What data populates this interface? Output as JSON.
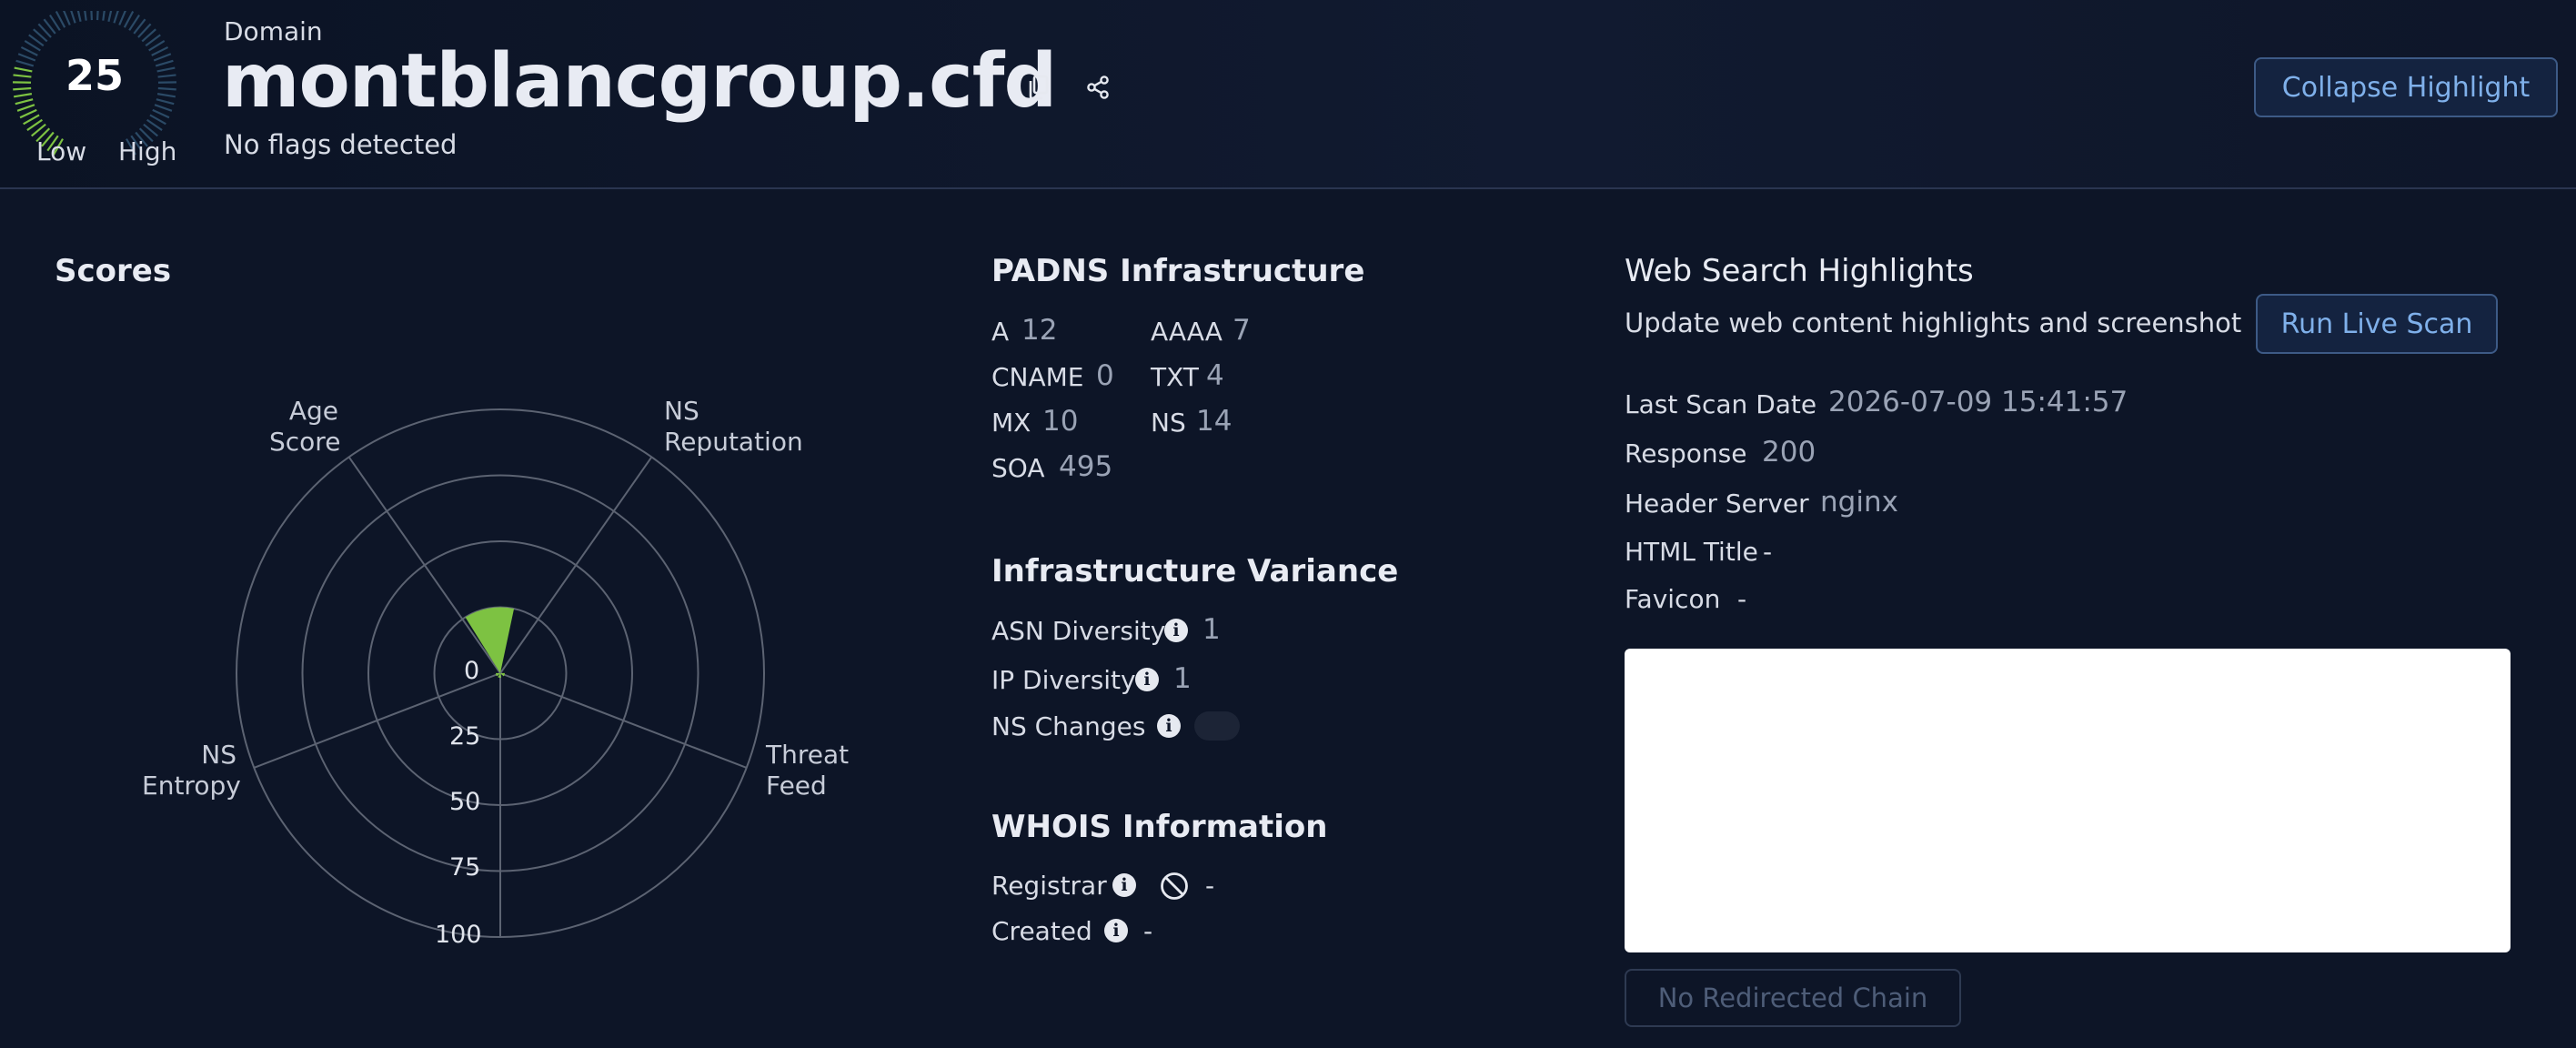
{
  "header": {
    "score": "25",
    "gauge_low": "Low",
    "gauge_high": "High",
    "domain_label": "Domain",
    "domain_name": "montblancgroup.cfd",
    "flags": "No flags detected",
    "collapse_label": "Collapse Highlight",
    "score_fraction": 0.25,
    "gauge_active_color": "#7dc242"
  },
  "scores": {
    "title": "Scores",
    "axes": [
      {
        "line1": "Age",
        "line2": "Score"
      },
      {
        "line1": "NS",
        "line2": "Reputation"
      },
      {
        "line1": "Threat",
        "line2": "Feed"
      },
      {
        "line1": "NS",
        "line2": "Entropy"
      }
    ],
    "ticks": [
      "0",
      "25",
      "50",
      "75",
      "100"
    ]
  },
  "chart_data": {
    "type": "radar",
    "categories": [
      "NS Reputation",
      "Threat Feed",
      "NS Entropy",
      "Age Score"
    ],
    "values": [
      0,
      0,
      0,
      25
    ],
    "rlim": [
      0,
      100
    ],
    "ticks": [
      0,
      25,
      50,
      75,
      100
    ],
    "color": "#7dc242",
    "grid": true
  },
  "padns": {
    "title": "PADNS Infrastructure",
    "records": [
      {
        "label": "A",
        "value": "12"
      },
      {
        "label": "AAAA",
        "value": "7"
      },
      {
        "label": "CNAME",
        "value": "0"
      },
      {
        "label": "TXT",
        "value": "4"
      },
      {
        "label": "MX",
        "value": "10"
      },
      {
        "label": "NS",
        "value": "14"
      },
      {
        "label": "SOA",
        "value": "495"
      }
    ]
  },
  "variance": {
    "title": "Infrastructure Variance",
    "asn_label": "ASN Diversity",
    "asn_value": "1",
    "ip_label": "IP Diversity",
    "ip_value": "1",
    "ns_label": "NS Changes"
  },
  "whois": {
    "title": "WHOIS Information",
    "registrar_label": "Registrar",
    "registrar_value": "-",
    "created_label": "Created",
    "created_value": "-"
  },
  "web": {
    "title": "Web Search Highlights",
    "subtitle": "Update web content highlights and screenshot",
    "run_label": "Run Live Scan",
    "scan_date_label": "Last Scan Date",
    "scan_date_value": "2026-07-09 15:41:57",
    "response_label": "Response",
    "response_value": "200",
    "server_label": "Header Server",
    "server_value": "nginx",
    "html_title_label": "HTML Title",
    "html_title_value": "-",
    "favicon_label": "Favicon",
    "favicon_value": "-",
    "redirect_label": "No Redirected Chain"
  },
  "info_glyph": "i"
}
